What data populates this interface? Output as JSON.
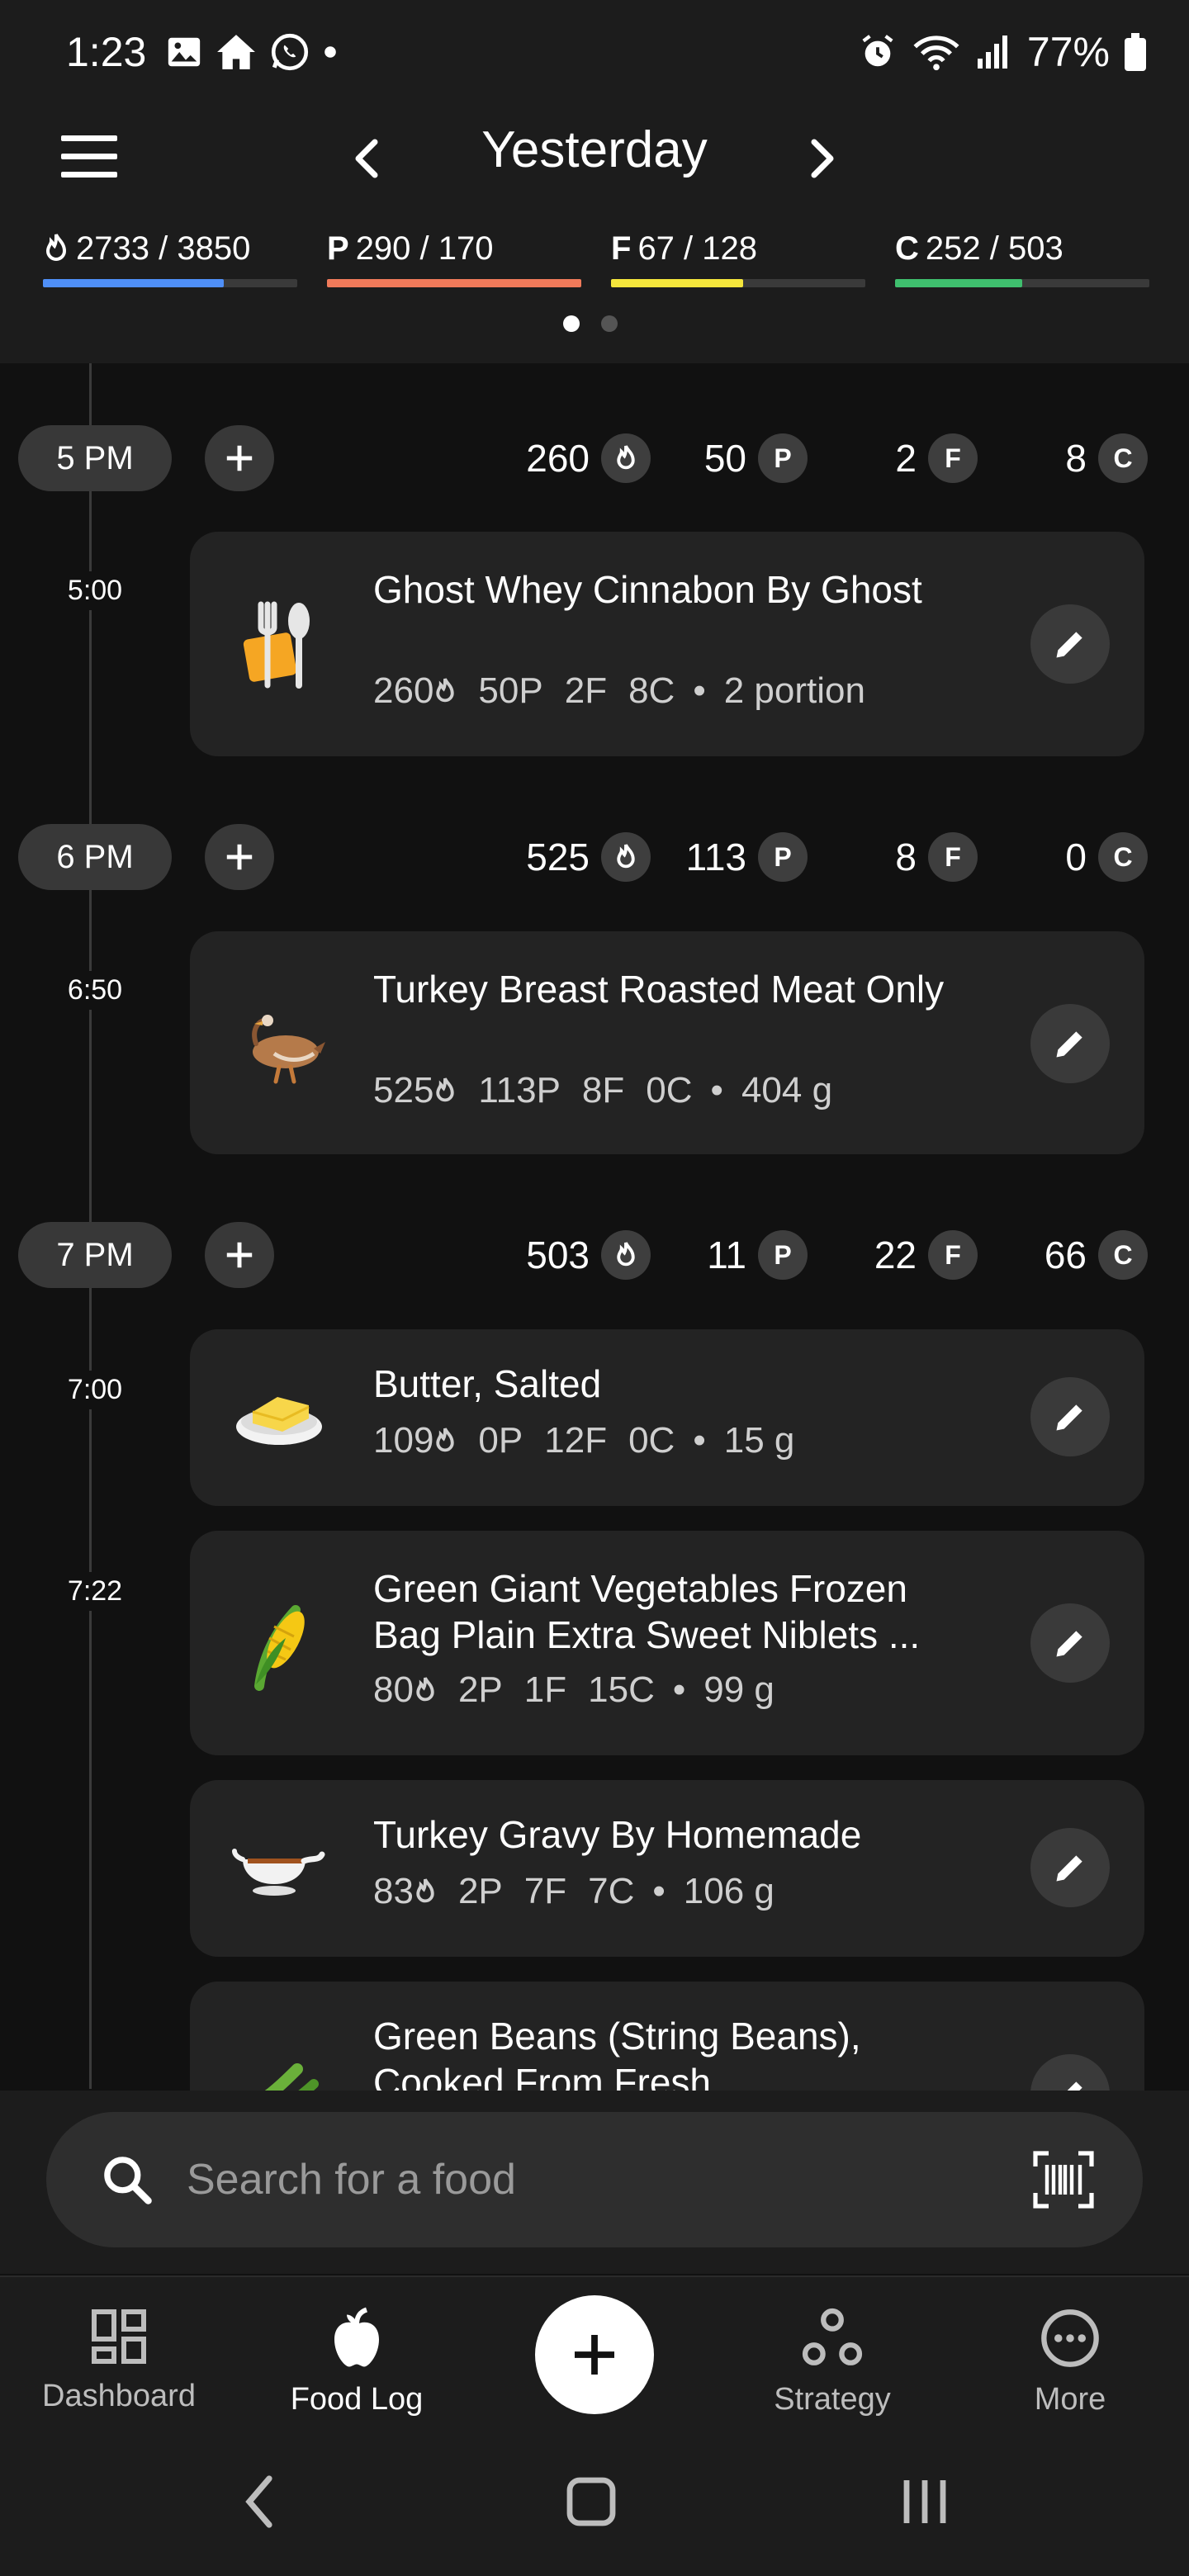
{
  "status_bar": {
    "time": "1:23",
    "battery": "77%"
  },
  "header": {
    "date_label": "Yesterday",
    "macros": [
      {
        "key": "calories",
        "prefix": "",
        "text": "2733 / 3850",
        "color": "#4f8ff7",
        "progress": 0.71
      },
      {
        "key": "protein",
        "prefix": "P",
        "text": "290 / 170",
        "color": "#f07a5a",
        "progress": 1.0
      },
      {
        "key": "fat",
        "prefix": "F",
        "text": "67 / 128",
        "color": "#f5e63c",
        "progress": 0.52
      },
      {
        "key": "carbs",
        "prefix": "C",
        "text": "252 / 503",
        "color": "#3fbf6e",
        "progress": 0.5
      }
    ],
    "pages": 2,
    "active_page": 0
  },
  "hours": [
    {
      "label": "5 PM",
      "cal": "260",
      "p": "50",
      "f": "2",
      "c": "8"
    },
    {
      "label": "6 PM",
      "cal": "525",
      "p": "113",
      "f": "8",
      "c": "0"
    },
    {
      "label": "7 PM",
      "cal": "503",
      "p": "11",
      "f": "22",
      "c": "66"
    }
  ],
  "chip_labels": {
    "p": "P",
    "f": "F",
    "c": "C"
  },
  "times": [
    "5:00",
    "6:50",
    "7:00",
    "7:22"
  ],
  "entries": [
    {
      "name": "Ghost Whey Cinnabon By Ghost",
      "cal": "260",
      "p": "50P",
      "f": "2F",
      "c": "8C",
      "portion": "2 portion",
      "icon": "fork-knife-icon"
    },
    {
      "name": "Turkey Breast Roasted Meat Only",
      "cal": "525",
      "p": "113P",
      "f": "8F",
      "c": "0C",
      "portion": "404 g",
      "icon": "turkey-icon"
    },
    {
      "name": "Butter, Salted",
      "cal": "109",
      "p": "0P",
      "f": "12F",
      "c": "0C",
      "portion": "15 g",
      "icon": "butter-icon"
    },
    {
      "name": "Green Giant Vegetables Frozen Bag Plain Extra Sweet Niblets ...",
      "cal": "80",
      "p": "2P",
      "f": "1F",
      "c": "15C",
      "portion": "99 g",
      "icon": "corn-icon"
    },
    {
      "name": "Turkey Gravy By Homemade",
      "cal": "83",
      "p": "2P",
      "f": "7F",
      "c": "7C",
      "portion": "106 g",
      "icon": "gravy-boat-icon"
    },
    {
      "name": "Green Beans (String Beans), Cooked From Fresh",
      "icon": "green-beans-icon"
    }
  ],
  "search": {
    "placeholder": "Search for a food"
  },
  "nav": {
    "dashboard": "Dashboard",
    "food_log": "Food Log",
    "strategy": "Strategy",
    "more": "More"
  }
}
